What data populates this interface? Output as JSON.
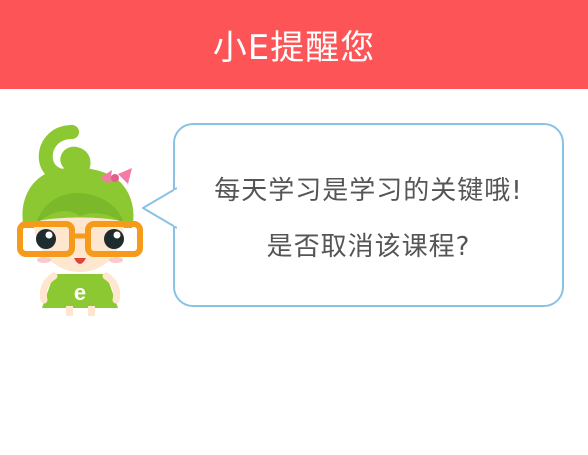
{
  "header": {
    "title": "小E提醒您",
    "background_color": "#fd5557"
  },
  "mascot": {
    "icon": "mascot-girl-icon",
    "badge_letter": "e"
  },
  "dialog": {
    "line1": "每天学习是学习的关键哦!",
    "line2": "是否取消该课程?",
    "border_color": "#8ac2e6",
    "text_color": "#555555"
  }
}
